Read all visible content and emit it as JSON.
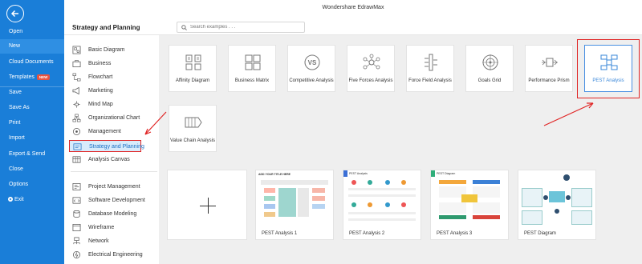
{
  "app": {
    "title": "Wondershare EdrawMax"
  },
  "nav": {
    "items": [
      {
        "label": "Open"
      },
      {
        "label": "New"
      },
      {
        "label": "Cloud Documents"
      },
      {
        "label": "Templates",
        "badge": "NEW"
      },
      {
        "label": "Save"
      },
      {
        "label": "Save As"
      },
      {
        "label": "Print"
      },
      {
        "label": "Import"
      },
      {
        "label": "Export & Send"
      },
      {
        "label": "Close"
      },
      {
        "label": "Options"
      },
      {
        "label": "Exit"
      }
    ]
  },
  "panel": {
    "title": "Strategy and Planning"
  },
  "search": {
    "placeholder": "Search examples . . ."
  },
  "categories": [
    {
      "label": "Basic Diagram",
      "icon": "basic-diagram-icon"
    },
    {
      "label": "Business",
      "icon": "business-icon"
    },
    {
      "label": "Flowchart",
      "icon": "flowchart-icon"
    },
    {
      "label": "Marketing",
      "icon": "marketing-icon"
    },
    {
      "label": "Mind Map",
      "icon": "mind-map-icon"
    },
    {
      "label": "Organizational Chart",
      "icon": "org-chart-icon"
    },
    {
      "label": "Management",
      "icon": "management-icon"
    },
    {
      "label": "Strategy and Planning",
      "icon": "strategy-icon"
    },
    {
      "label": "Analysis Canvas",
      "icon": "analysis-canvas-icon"
    },
    {
      "label": "Project Management",
      "icon": "project-management-icon"
    },
    {
      "label": "Software Development",
      "icon": "software-development-icon"
    },
    {
      "label": "Database Modeling",
      "icon": "database-icon"
    },
    {
      "label": "Wireframe",
      "icon": "wireframe-icon"
    },
    {
      "label": "Network",
      "icon": "network-icon"
    },
    {
      "label": "Electrical Engineering",
      "icon": "electrical-icon"
    }
  ],
  "diagram_types": [
    {
      "label": "Affinity Diagram",
      "icon": "affinity-diagram-icon"
    },
    {
      "label": "Business Matrix",
      "icon": "business-matrix-icon"
    },
    {
      "label": "Competitive Analysis",
      "icon": "competitive-analysis-icon"
    },
    {
      "label": "Five Forces Analysis",
      "icon": "five-forces-icon"
    },
    {
      "label": "Force Field Analysis",
      "icon": "force-field-icon"
    },
    {
      "label": "Goals Grid",
      "icon": "goals-grid-icon"
    },
    {
      "label": "Performance Prism",
      "icon": "performance-prism-icon"
    },
    {
      "label": "PEST Analysis",
      "icon": "pest-analysis-icon"
    },
    {
      "label": "Value Chain Analysis",
      "icon": "value-chain-icon"
    }
  ],
  "templates": [
    {
      "label": "PEST Analysis 1",
      "preview_title": "ADD YOUR TITLE HERE"
    },
    {
      "label": "PEST Analysis 2",
      "preview_title": "PEST Analysis"
    },
    {
      "label": "PEST Analysis 3",
      "preview_title": "PEST Diagram"
    },
    {
      "label": "PEST Diagram"
    }
  ],
  "colors": {
    "nav_bg": "#1a7ed8",
    "highlight_red": "#e02424",
    "selected_blue": "#4a90e2"
  }
}
